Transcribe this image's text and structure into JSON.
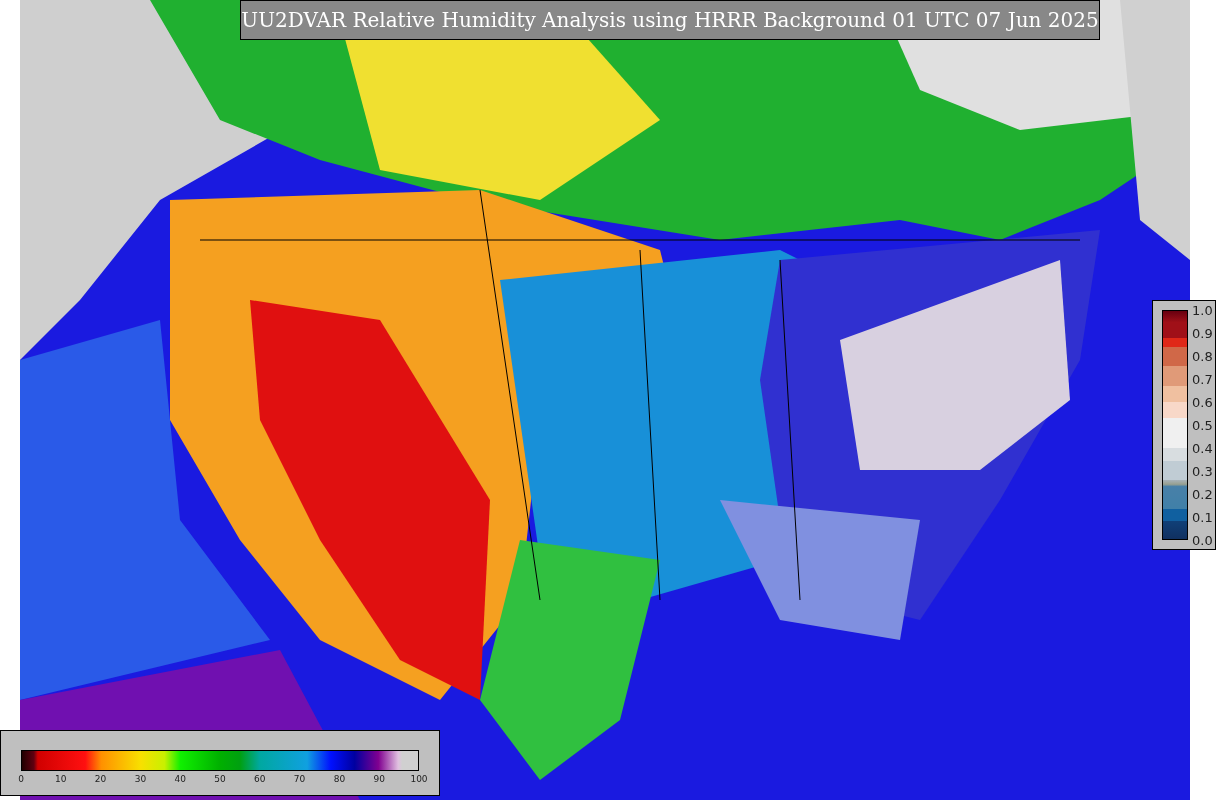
{
  "title": "UU2DVAR Relative Humidity Analysis using HRRR Background 01 UTC 07 Jun 2025",
  "humidity_colorbar": {
    "ticks": [
      "0",
      "10",
      "20",
      "30",
      "40",
      "50",
      "60",
      "70",
      "80",
      "90",
      "100"
    ]
  },
  "ratio_colorbar": {
    "ticks": [
      "1.0",
      "0.9",
      "0.8",
      "0.7",
      "0.6",
      "0.5",
      "0.4",
      "0.3",
      "0.2",
      "0.1",
      "0.0"
    ]
  }
}
